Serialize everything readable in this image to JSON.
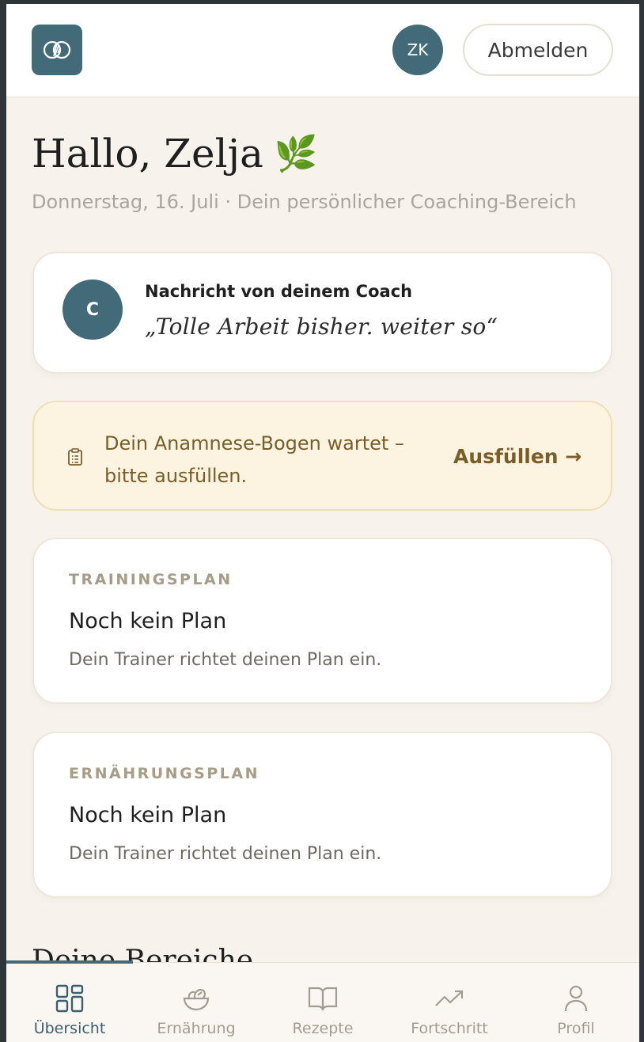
{
  "header": {
    "logo_icon": "intersecting-circles-icon",
    "user_initials": "ZK",
    "logout_label": "Abmelden",
    "brand_color": "#426a78"
  },
  "greeting": {
    "title": "Hallo, Zelja",
    "emoji": "🌿",
    "subtitle": "Donnerstag, 16. Juli · Dein persönlicher Coaching-Bereich"
  },
  "coach_message": {
    "avatar_initial": "C",
    "title": "Nachricht von deinem Coach",
    "message": "„Tolle Arbeit bisher. weiter so“"
  },
  "anamnesis_alert": {
    "icon": "clipboard-icon",
    "text": "Dein Anamnese-Bogen wartet – bitte ausfüllen.",
    "action_label": "Ausfüllen →",
    "accent_color": "#7a5e2a"
  },
  "plans": [
    {
      "label": "TRAININGSPLAN",
      "title": "Noch kein Plan",
      "description": "Dein Trainer richtet deinen Plan ein."
    },
    {
      "label": "ERNÄHRUNGSPLAN",
      "title": "Noch kein Plan",
      "description": "Dein Trainer richtet deinen Plan ein."
    }
  ],
  "sections_heading": "Deine Bereiche",
  "bottom_nav": {
    "active": "Übersicht",
    "items": [
      {
        "label": "Übersicht",
        "icon": "grid-icon"
      },
      {
        "label": "Ernährung",
        "icon": "salad-bowl-icon"
      },
      {
        "label": "Rezepte",
        "icon": "open-book-icon"
      },
      {
        "label": "Fortschritt",
        "icon": "trending-up-icon"
      },
      {
        "label": "Profil",
        "icon": "user-icon"
      }
    ]
  }
}
